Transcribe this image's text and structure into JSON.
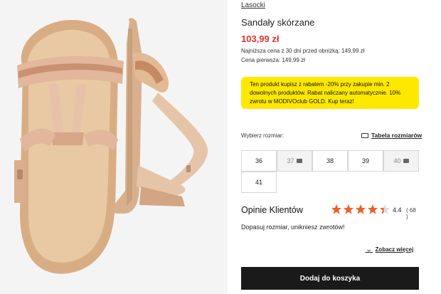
{
  "product": {
    "brand": "Lasocki",
    "title": "Sandały skórzane",
    "price": "103,99 zł",
    "lowest_price": "Najniższa cena z 30 dni przed obniżką: 149,99 zł",
    "first_price": "Cena pierwsza: 149,99 zł"
  },
  "promo": {
    "text": "Ten produkt kupisz z rabatem -20% przy zakupie min. 2 dowolnych produktów. Rabat naliczany automatycznie. 10% zwrotu w MODIVOclub GOLD. Kup teraz!",
    "color": "#ffe800"
  },
  "sizes": {
    "label": "Wybierz rozmiar:",
    "table_link": "Tabela rozmiarów",
    "options": [
      {
        "label": "36",
        "available": true
      },
      {
        "label": "37",
        "available": false
      },
      {
        "label": "38",
        "available": true
      },
      {
        "label": "39",
        "available": true
      },
      {
        "label": "40",
        "available": false
      },
      {
        "label": "41",
        "available": true
      }
    ]
  },
  "reviews": {
    "title": "Opinie Klientów",
    "rating": "4.4",
    "rating_value": 4.4,
    "rating_max": 5,
    "count": "( 68 )",
    "hint": "Dopasuj rozmiar, unikniesz zwrotów!",
    "see_more": "Zobacz więcej",
    "star_color": "#e8612a"
  },
  "cart": {
    "add_label": "Dodaj do koszyka"
  },
  "colors": {
    "price": "#e0332e",
    "button": "#1a1a1a"
  }
}
